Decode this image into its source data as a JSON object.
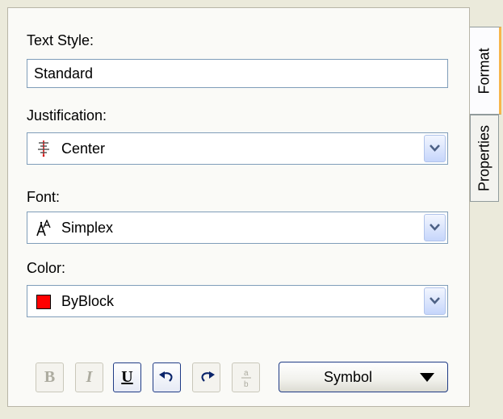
{
  "panel": {
    "text_style": {
      "label": "Text Style:",
      "value": "Standard"
    },
    "justification": {
      "label": "Justification:",
      "value": "Center",
      "icon": "justify-center-icon"
    },
    "font": {
      "label": "Font:",
      "value": "Simplex",
      "icon": "font-icon"
    },
    "color": {
      "label": "Color:",
      "value": "ByBlock",
      "swatch": "#ff0000"
    }
  },
  "toolbar": {
    "bold": "B",
    "italic": "I",
    "underline": "U",
    "undo_icon": "undo-icon",
    "redo_icon": "redo-icon",
    "stack_icon": "stack-fraction-icon",
    "symbol_label": "Symbol"
  },
  "tabs": [
    {
      "label": "Format",
      "active": true
    },
    {
      "label": "Properties",
      "active": false
    }
  ],
  "colors": {
    "accent_tab": "#f7b64b",
    "field_border": "#7f9db9",
    "button_border": "#1f3b86"
  }
}
